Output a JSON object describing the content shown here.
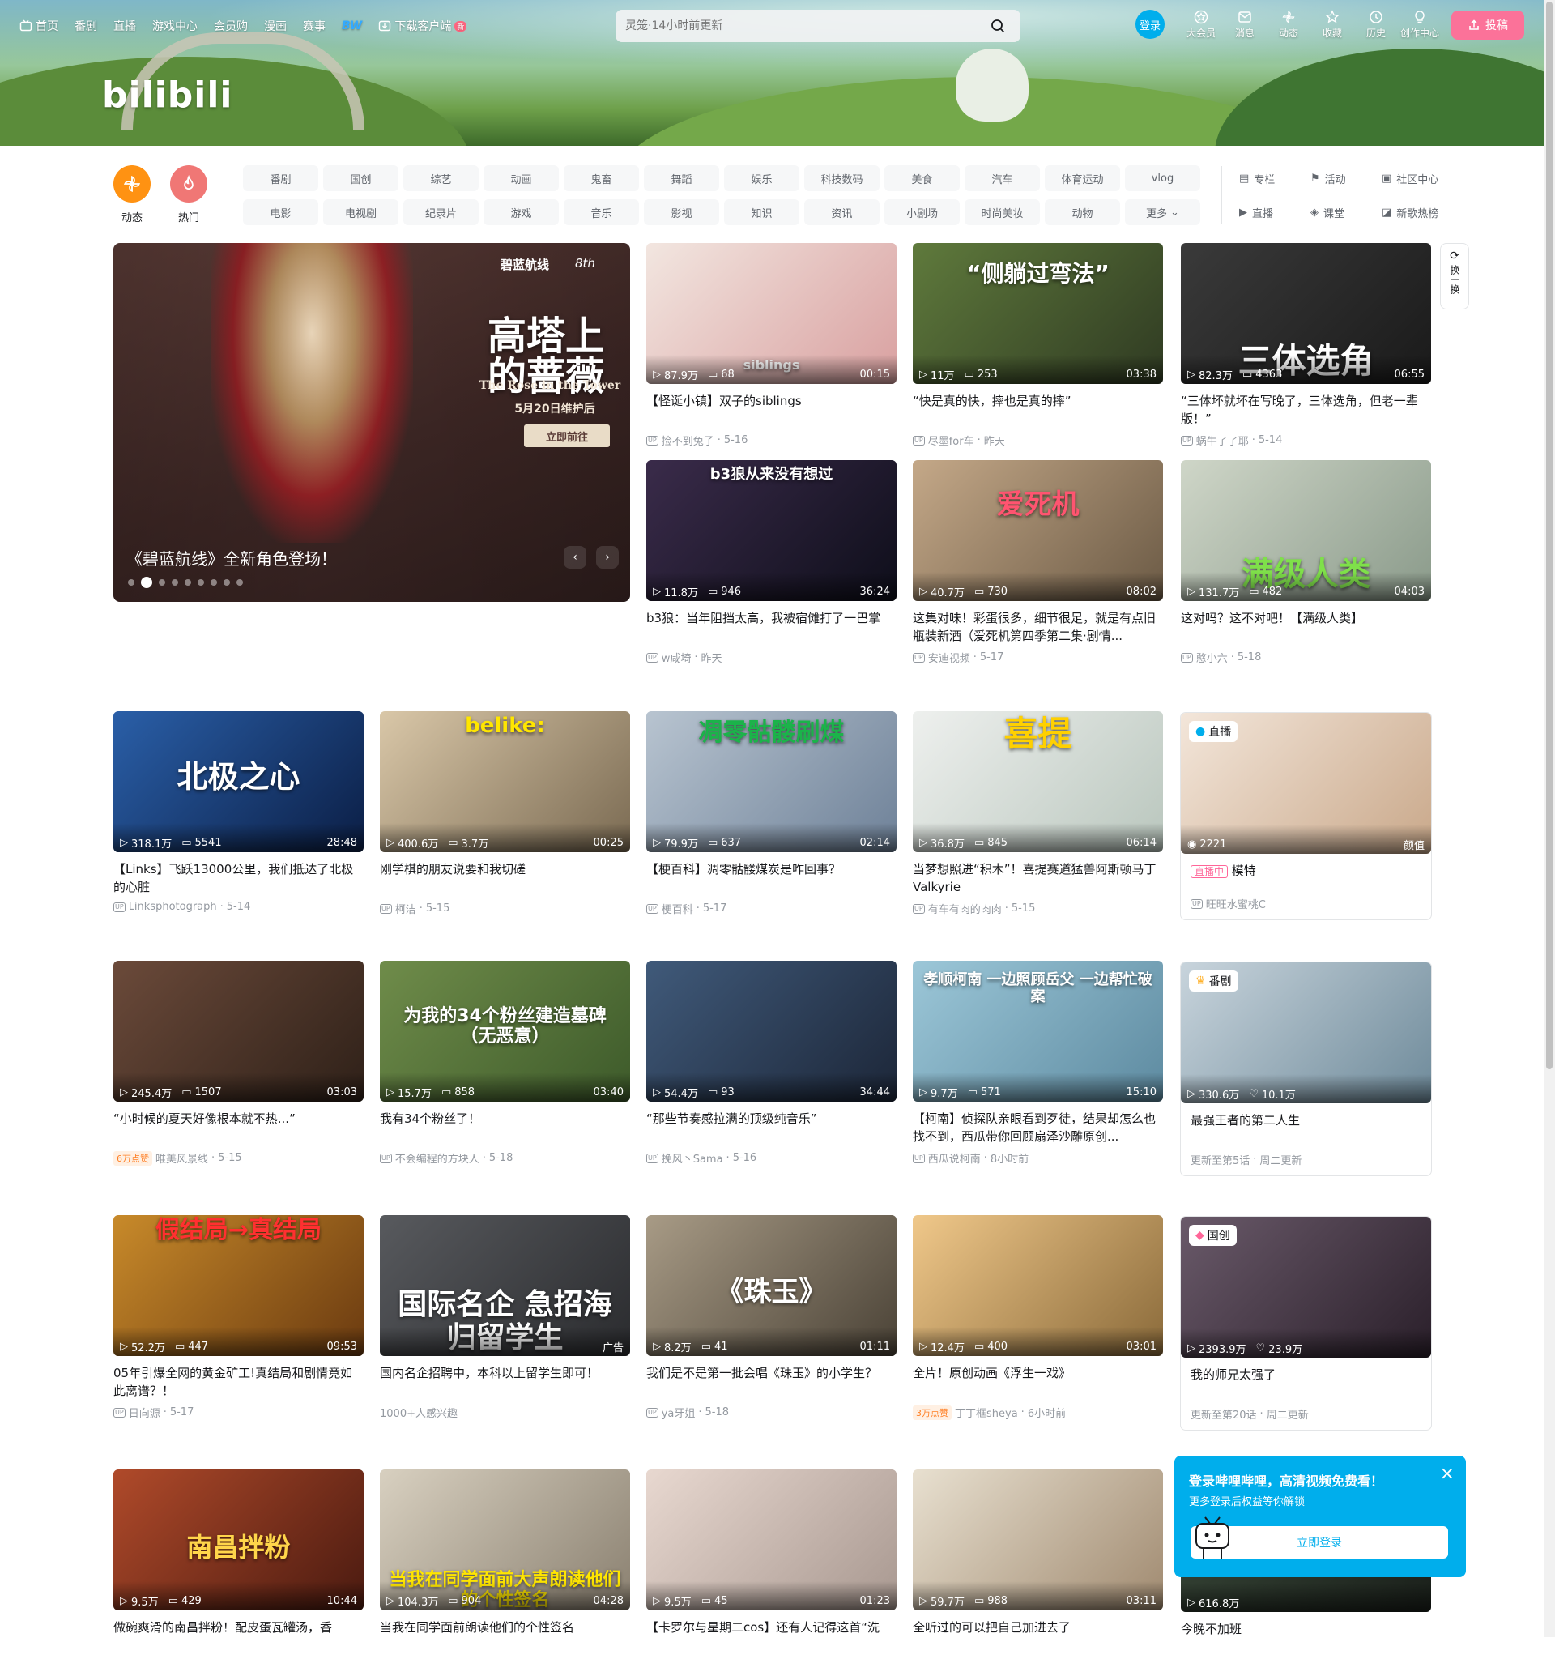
{
  "topnav": {
    "items": [
      "首页",
      "番剧",
      "直播",
      "游戏中心",
      "会员购",
      "漫画",
      "赛事"
    ],
    "special": "BW",
    "download": "下载客户端",
    "download_badge": "新"
  },
  "search": {
    "placeholder": "灵笼·14小时前更新"
  },
  "right_nav": {
    "login": "登录",
    "items": [
      "大会员",
      "消息",
      "动态",
      "收藏",
      "历史",
      "创作中心"
    ],
    "upload": "投稿"
  },
  "channels": {
    "dynamic": "动态",
    "hot": "热门",
    "chips": [
      "番剧",
      "国创",
      "综艺",
      "动画",
      "鬼畜",
      "舞蹈",
      "娱乐",
      "科技数码",
      "美食",
      "汽车",
      "体育运动",
      "vlog",
      "电影",
      "电视剧",
      "纪录片",
      "游戏",
      "音乐",
      "影视",
      "知识",
      "资讯",
      "小剧场",
      "时尚美妆",
      "动物",
      "更多"
    ],
    "side": [
      "专栏",
      "活动",
      "社区中心",
      "直播",
      "课堂",
      "新歌热榜"
    ]
  },
  "carousel": {
    "caption": "《碧蓝航线》全新角色登场！",
    "brand": "碧蓝航线",
    "brand2": "8th",
    "poster_title": "高塔上的蔷薇",
    "poster_sub": "The Rose in the Tower",
    "poster_date": "5月20日维护后",
    "poster_cta": "立即前往",
    "dot_count": 9,
    "active_dot": 1
  },
  "refresh_label": "换一换",
  "videos": [
    {
      "id": "v1",
      "views": "87.9万",
      "danmaku": "68",
      "duration": "00:15",
      "title": "【怪诞小镇】双子的siblings",
      "up": "捡不到兔子",
      "date": "5-16",
      "overlay": "siblings",
      "color1": "#f2e6e0",
      "color2": "#d9a0a0"
    },
    {
      "id": "v2",
      "views": "11万",
      "danmaku": "253",
      "duration": "03:38",
      "title": "“快是真的快，摔也是真的摔”",
      "up": "尽墨for车",
      "date": "昨天",
      "overlay": "“侧躺过弯法”",
      "color1": "#5f7a3c",
      "color2": "#2f3a22"
    },
    {
      "id": "v3",
      "views": "82.3万",
      "danmaku": "4363",
      "duration": "06:55",
      "title": "“三体坏就坏在写晚了，三体选角，但老一辈版！”",
      "up": "蜗牛了了耶",
      "date": "5-14",
      "overlay": "三体选角",
      "color1": "#3a3a3a",
      "color2": "#1a1a1a"
    },
    {
      "id": "v4",
      "views": "11.8万",
      "danmaku": "946",
      "duration": "36:24",
      "title": "b3狼：当年阻挡太高，我被宿傩打了一巴掌",
      "up": "w咸埼",
      "date": "昨天",
      "overlay": "b3狼从来没有想过",
      "color1": "#3a2b4a",
      "color2": "#0e0e1a"
    },
    {
      "id": "v5",
      "views": "40.7万",
      "danmaku": "730",
      "duration": "08:02",
      "title": "这集对味！彩蛋很多，细节很足，就是有点旧瓶装新酒（爱死机第四季第二集·剧情...",
      "up": "安迪视频",
      "date": "5-17",
      "overlay": "爱死机",
      "color1": "#c4a888",
      "color2": "#6b5a45"
    },
    {
      "id": "v6",
      "views": "131.7万",
      "danmaku": "482",
      "duration": "04:03",
      "title": "这对吗？这不对吧！【满级人类】",
      "up": "憨小六",
      "date": "5-18",
      "overlay": "满级人类",
      "color1": "#cfd6c8",
      "color2": "#8a9a8a"
    },
    {
      "id": "v7",
      "views": "318.1万",
      "danmaku": "5541",
      "duration": "28:48",
      "title": "【Links】飞跃13000公里，我们抵达了北极的心脏",
      "up": "Linksphotograph",
      "date": "5-14",
      "overlay": "北极之心",
      "color1": "#2a5fa8",
      "color2": "#0b1e45"
    },
    {
      "id": "v8",
      "views": "400.6万",
      "danmaku": "3.7万",
      "duration": "00:25",
      "title": "刚学棋的朋友说要和我切磋",
      "up": "柯洁",
      "date": "5-15",
      "overlay": "belike:",
      "color1": "#d9c7a8",
      "color2": "#7a6a52"
    },
    {
      "id": "v9",
      "views": "79.9万",
      "danmaku": "637",
      "duration": "02:14",
      "title": "【梗百科】凋零骷髅煤炭是咋回事？",
      "up": "梗百科",
      "date": "5-17",
      "overlay": "凋零骷髅刷煤",
      "color1": "#b8c4d0",
      "color2": "#6e8198"
    },
    {
      "id": "v10",
      "views": "36.8万",
      "danmaku": "845",
      "duration": "06:14",
      "title": "当梦想照进“积木”！喜提赛道猛兽阿斯顿马丁Valkyrie",
      "up": "有车有肉的肉肉",
      "date": "5-15",
      "overlay": "喜提",
      "color1": "#eef0ee",
      "color2": "#b9c6bd"
    },
    {
      "id": "v11",
      "views": "245.4万",
      "danmaku": "1507",
      "duration": "03:03",
      "title": "“小时候的夏天好像根本就不热...”",
      "up": "唯美风景线",
      "date": "5-15",
      "like_tag": "6万点赞",
      "overlay": "",
      "color1": "#6b4a3a",
      "color2": "#2e2018"
    },
    {
      "id": "v12",
      "views": "15.7万",
      "danmaku": "858",
      "duration": "03:40",
      "title": "我有34个粉丝了！",
      "up": "不会编程的方块人",
      "date": "5-18",
      "overlay": "为我的34个粉丝建造墓碑（无恶意）",
      "color1": "#6f8c4a",
      "color2": "#3d5a2a"
    },
    {
      "id": "v13",
      "views": "54.4万",
      "danmaku": "93",
      "duration": "34:44",
      "title": "“那些节奏感拉满的顶级纯音乐”",
      "up": "挽风丶Sama",
      "date": "5-16",
      "overlay": "",
      "color1": "#405a7a",
      "color2": "#1c2638"
    },
    {
      "id": "v14",
      "views": "9.7万",
      "danmaku": "571",
      "duration": "15:10",
      "title": "【柯南】侦探队亲眼看到歹徒，结果却怎么也找不到，西瓜带你回顾扇泽沙雕原创...",
      "up": "西瓜说柯南",
      "date": "8小时前",
      "overlay": "孝顺柯南 一边照顾岳父 一边帮忙破案",
      "color1": "#9cc7d8",
      "color2": "#5d8aa0"
    },
    {
      "id": "v15",
      "views": "52.2万",
      "danmaku": "447",
      "duration": "09:53",
      "title": "05年引爆全网的黄金矿工!真结局和剧情竟如此离谱？！",
      "up": "日向源",
      "date": "5-17",
      "overlay": "假结局→真结局",
      "color1": "#c88a2a",
      "color2": "#6a3a10"
    },
    {
      "id": "v16",
      "views": "",
      "danmaku": "",
      "duration": "广告",
      "title": "国内名企招聘中，本科以上留学生即可！",
      "up": "",
      "date": "",
      "interest": "1000+人感兴趣",
      "overlay": "国际名企 急招海归留学生",
      "color1": "#585a5e",
      "color2": "#2a2b2e"
    },
    {
      "id": "v17",
      "views": "8.2万",
      "danmaku": "41",
      "duration": "01:11",
      "title": "我们是不是第一批会唱《珠玉》的小学生？",
      "up": "ya牙姐",
      "date": "5-18",
      "overlay": "《珠玉》",
      "color1": "#a89b86",
      "color2": "#4a4236"
    },
    {
      "id": "v18",
      "views": "12.4万",
      "danmaku": "400",
      "duration": "03:01",
      "title": "全片！原创动画《浮生一戏》",
      "up": "丁丁框sheya",
      "date": "6小时前",
      "like_tag": "3万点赞",
      "overlay": "",
      "color1": "#f0c88a",
      "color2": "#8a6a3a"
    },
    {
      "id": "v19",
      "views": "9.5万",
      "danmaku": "429",
      "duration": "10:44",
      "title": "做碗爽滑的南昌拌粉！配皮蛋瓦罐汤，香",
      "up": "",
      "date": "",
      "overlay": "南昌拌粉",
      "color1": "#b04a2a",
      "color2": "#4a1a10"
    },
    {
      "id": "v20",
      "views": "104.3万",
      "danmaku": "904",
      "duration": "04:28",
      "title": "当我在同学面前朗读他们的个性签名",
      "up": "",
      "date": "",
      "overlay": "当我在同学面前大声朗读他们的个性签名",
      "color1": "#d8d0c0",
      "color2": "#8a8070"
    },
    {
      "id": "v21",
      "views": "9.5万",
      "danmaku": "45",
      "duration": "01:23",
      "title": "【卡罗尔与星期二cos】还有人记得这首“洗",
      "up": "",
      "date": "",
      "overlay": "",
      "color1": "#e8d8d0",
      "color2": "#a89890"
    },
    {
      "id": "v22",
      "views": "59.7万",
      "danmaku": "988",
      "duration": "03:11",
      "title": "全听过的可以把自己加进去了",
      "up": "",
      "date": "",
      "overlay": "",
      "color1": "#e8e0d0",
      "color2": "#a08a70"
    }
  ],
  "specials": {
    "live": {
      "tag": "直播",
      "viewers": "2221",
      "category": "颜值",
      "status": "直播中",
      "title": "模特",
      "up": "旺旺水蜜桃C"
    },
    "bangumi": {
      "tag": "番剧",
      "views": "330.6万",
      "follows": "10.1万",
      "title": "最强王者的第二人生",
      "update": "更新至第5话",
      "schedule": "周二更新"
    },
    "guochuang": {
      "tag": "国创",
      "views": "2393.9万",
      "follows": "23.9万",
      "title": "我的师兄太强了",
      "update": "更新至第20话",
      "schedule": "周二更新"
    },
    "last": {
      "views": "616.8万",
      "title": "今晚不加班"
    }
  },
  "login_popup": {
    "title": "登录哔哩哔哩，高清视频免费看！",
    "subtitle": "更多登录后权益等你解锁",
    "button": "立即登录"
  }
}
